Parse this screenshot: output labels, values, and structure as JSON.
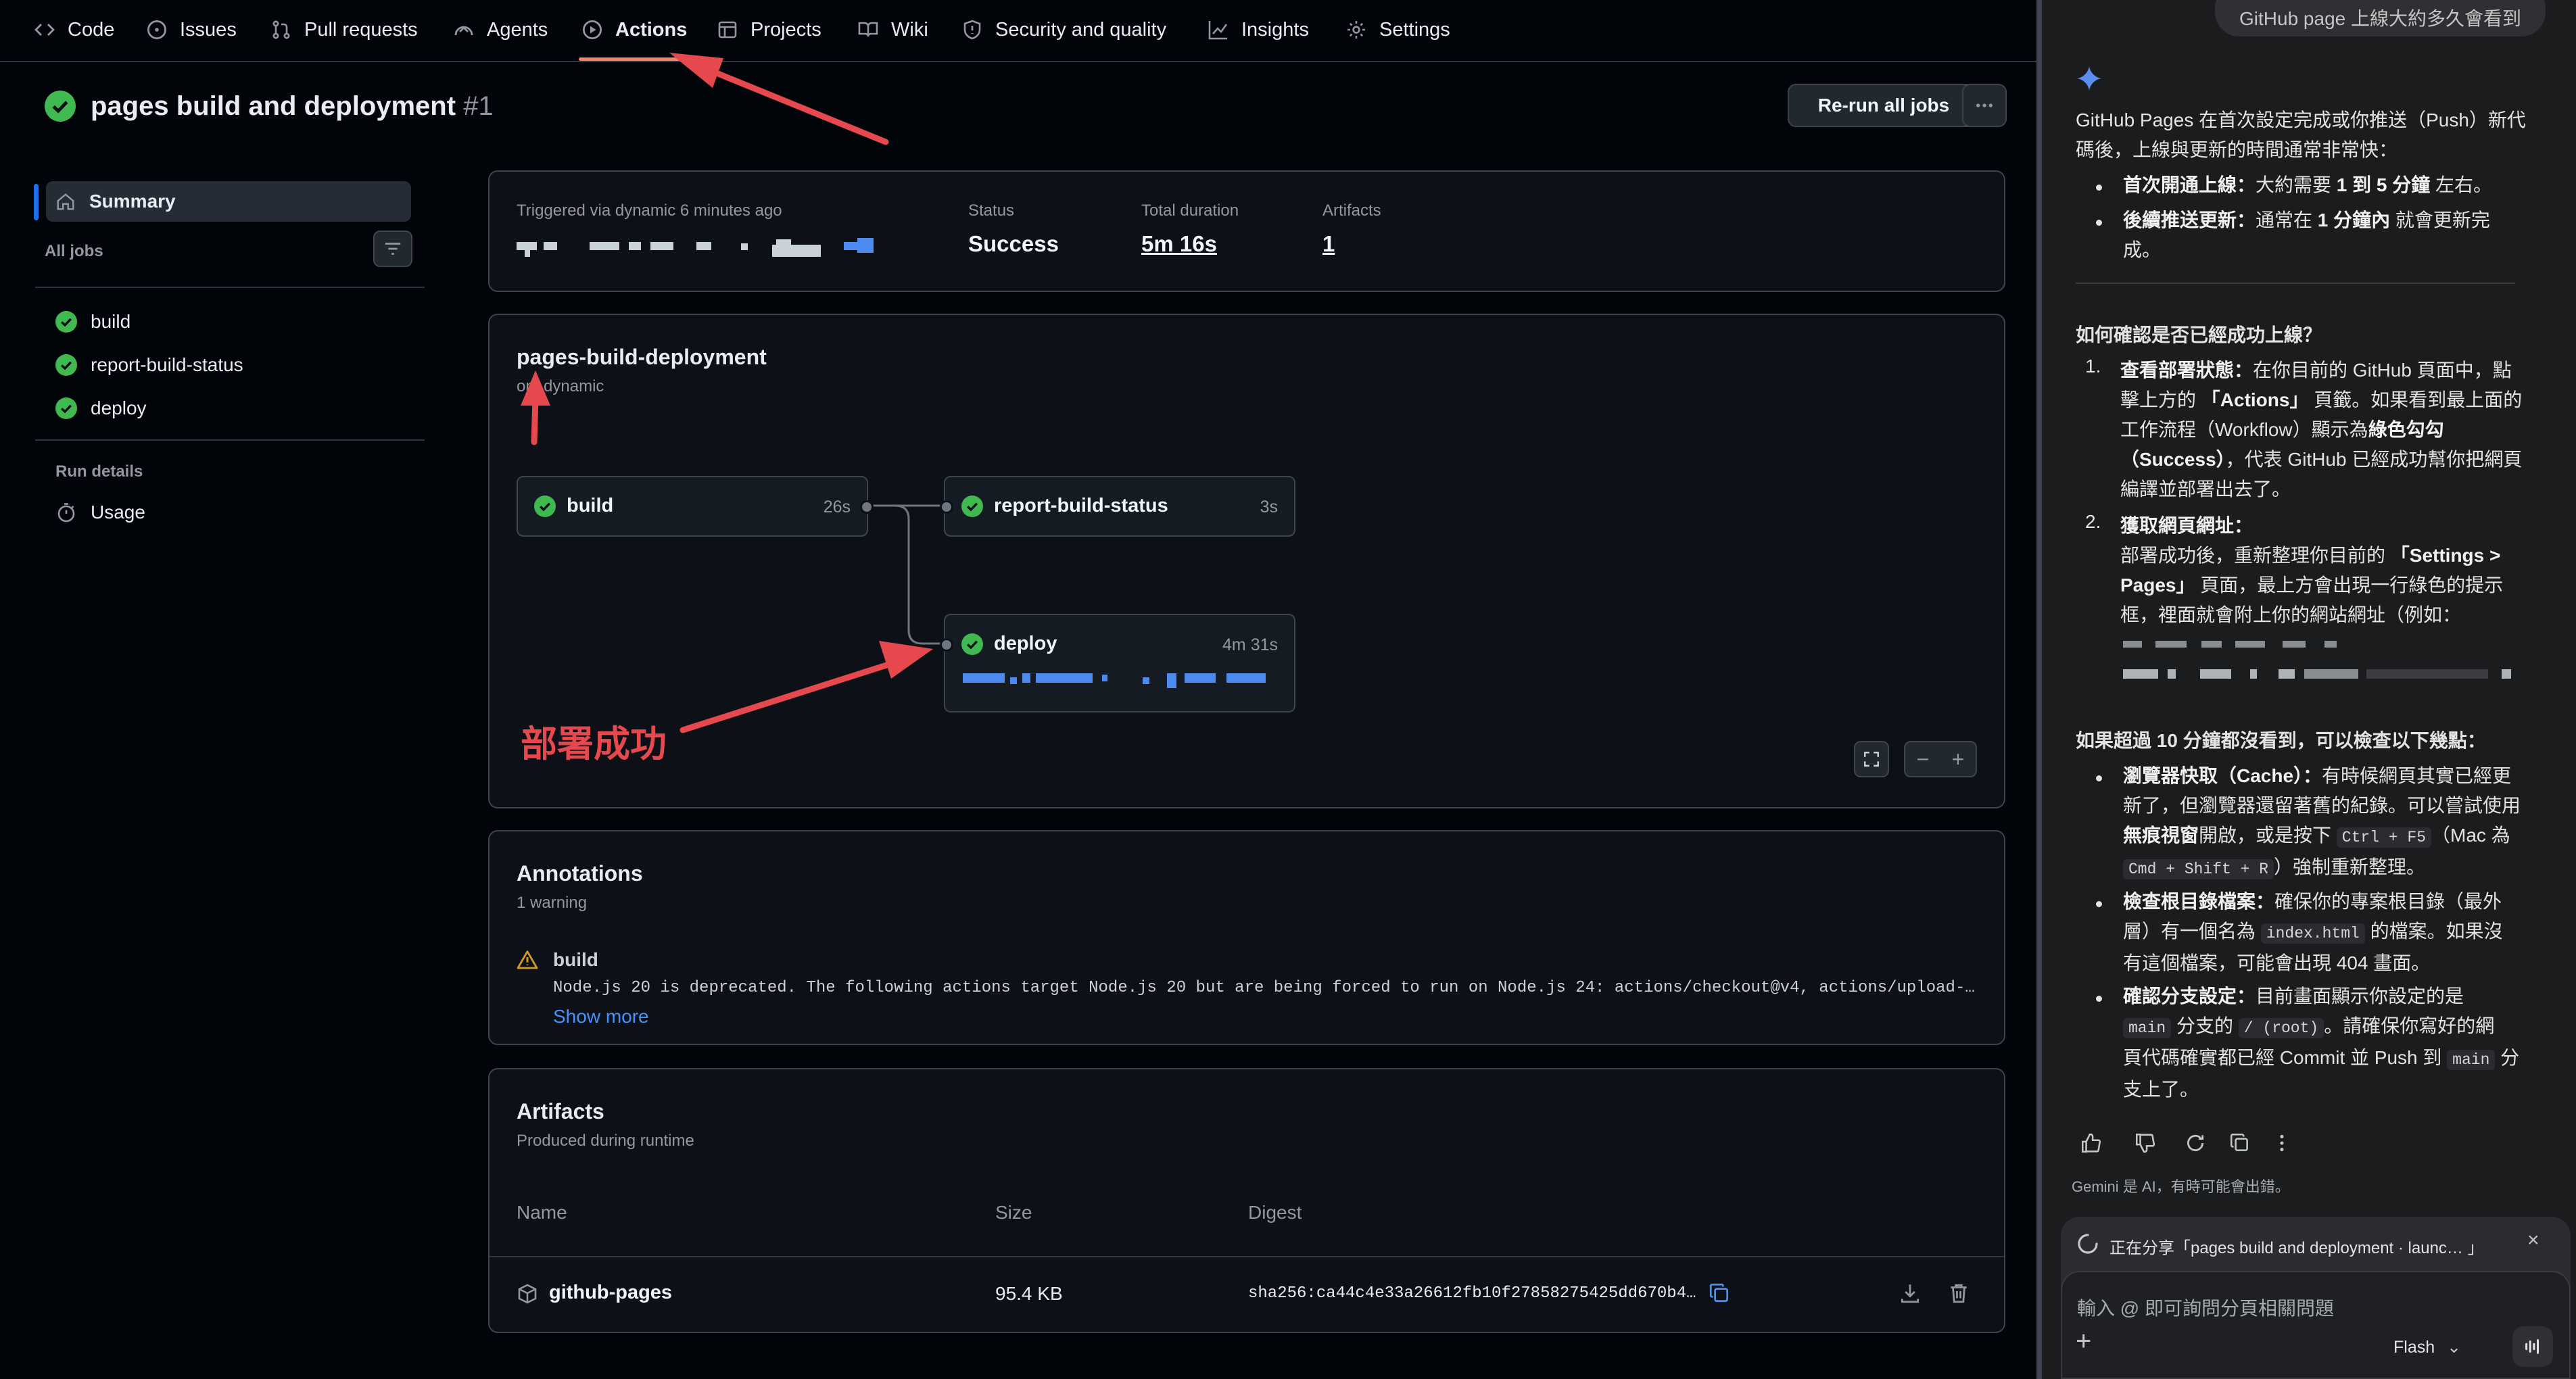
{
  "nav": {
    "tabs": [
      {
        "label": "Code",
        "icon": "code-icon"
      },
      {
        "label": "Issues",
        "icon": "issue-opened-icon"
      },
      {
        "label": "Pull requests",
        "icon": "pull-request-icon"
      },
      {
        "label": "Agents",
        "icon": "agent-icon"
      },
      {
        "label": "Actions",
        "icon": "play-icon",
        "selected": true
      },
      {
        "label": "Projects",
        "icon": "table-icon"
      },
      {
        "label": "Wiki",
        "icon": "book-icon"
      },
      {
        "label": "Security and quality",
        "icon": "shield-icon"
      },
      {
        "label": "Insights",
        "icon": "graph-icon"
      },
      {
        "label": "Settings",
        "icon": "gear-icon"
      }
    ]
  },
  "run": {
    "title": "pages build and deployment",
    "number": "#1",
    "rerun_label": "Re-run all jobs",
    "more_icon": "kebab-horizontal-icon"
  },
  "sidebar": {
    "summary": "Summary",
    "all_jobs": "All jobs",
    "jobs": [
      "build",
      "report-build-status",
      "deploy"
    ],
    "run_details": "Run details",
    "usage": "Usage"
  },
  "summary": {
    "triggered": "Triggered via dynamic 6 minutes ago",
    "status_label": "Status",
    "status_value": "Success",
    "duration_label": "Total duration",
    "duration_value": "5m 16s",
    "artifacts_label": "Artifacts",
    "artifacts_value": "1"
  },
  "workflow": {
    "name": "pages-build-deployment",
    "on": "on: dynamic",
    "jobs": [
      {
        "name": "build",
        "duration": "26s"
      },
      {
        "name": "report-build-status",
        "duration": "3s"
      },
      {
        "name": "deploy",
        "duration": "4m 31s"
      }
    ],
    "annotation_text": "部署成功"
  },
  "annotations": {
    "title": "Annotations",
    "count": "1 warning",
    "job": "build",
    "message": "Node.js 20 is deprecated. The following actions target Node.js 20 but are being forced to run on Node.js 24: actions/checkout@v4, actions/upload-…",
    "show_more": "Show more"
  },
  "artifacts": {
    "title": "Artifacts",
    "subtitle": "Produced during runtime",
    "columns": [
      "Name",
      "Size",
      "Digest"
    ],
    "rows": [
      {
        "name": "github-pages",
        "size": "95.4 KB",
        "digest": "sha256:ca44c4e33a26612fb10f27858275425dd670b4…"
      }
    ]
  },
  "gemini": {
    "user_msg": "GitHub page 上線大約多久會看到",
    "intro1": "GitHub Pages 在首次設定完成或你推送（Push）新代",
    "intro2": "碼後，上線與更新的時間通常非常快：",
    "b1_bold": "首次開通上線：",
    "b1_a": "大約需要 ",
    "b1_b": "1 到 5 分鐘",
    "b1_c": " 左右。",
    "b2_bold": "後續推送更新：",
    "b2_a": "通常在 ",
    "b2_b": "1 分鐘內",
    "b2_c": " 就會更新完",
    "b2_d": "成。",
    "h1": "如何確認是否已經成功上線？",
    "s1_num": "1.",
    "s1_bold": "查看部署狀態：",
    "s1_a": "在你目前的 GitHub 頁面中，點",
    "s1_b": "擊上方的 ",
    "s1_c": "「Actions」",
    "s1_d": " 頁籤。如果看到最上面的",
    "s1_e": "工作流程（Workflow）顯示為",
    "s1_f": "綠色勾勾",
    "s1_g": "（Success）",
    "s1_h": "，代表 GitHub 已經成功幫你把網頁",
    "s1_i": "編譯並部署出去了。",
    "s2_num": "2.",
    "s2_bold": "獲取網頁網址：",
    "s2_a": "部署成功後，重新整理你目前的 ",
    "s2_b": "「Settings >",
    "s2_c": "Pages」",
    "s2_d": " 頁面，最上方會出現一行綠色的提示",
    "s2_e": "框，裡面就會附上你的網站網址（例如：",
    "h2": "如果超過 10 分鐘都沒看到，可以檢查以下幾點：",
    "c1_bold": "瀏覽器快取（Cache）：",
    "c1_a": "有時候網頁其實已經更",
    "c1_b": "新了，但瀏覽器還留著舊的紀錄。可以嘗試使用",
    "c1_c": "無痕視窗",
    "c1_d": "開啟，或是按下 ",
    "c1_code1": "Ctrl + F5",
    "c1_e": "（Mac 為",
    "c1_code2": "Cmd + Shift + R",
    "c1_f": "）強制重新整理。",
    "c2_bold": "檢查根目錄檔案：",
    "c2_a": "確保你的專案根目錄（最外",
    "c2_b": "層）有一個名為 ",
    "c2_code": "index.html",
    "c2_c": " 的檔案。如果沒",
    "c2_d": "有這個檔案，可能會出現 404 畫面。",
    "c3_bold": "確認分支設定：",
    "c3_a": "目前畫面顯示你設定的是",
    "c3_code1": "main",
    "c3_b": " 分支的 ",
    "c3_code2": "/ (root)",
    "c3_c": "。請確保你寫好的網",
    "c3_d": "頁代碼確實都已經 Commit 並 Push 到 ",
    "c3_code3": "main",
    "c3_e": " 分",
    "c3_f": "支上了。",
    "disclaimer": "Gemini 是 AI，有時可能會出錯。",
    "sharing": "正在分享「pages build and deployment · launc… 」",
    "input_placeholder": "輸入 @ 即可詢問分頁相關問題",
    "model": "Flash"
  },
  "colors": {
    "accent": "#f78166",
    "success": "#3fb950",
    "link": "#4493f8",
    "warning": "#d29922",
    "annotation_red": "#e5484d"
  }
}
